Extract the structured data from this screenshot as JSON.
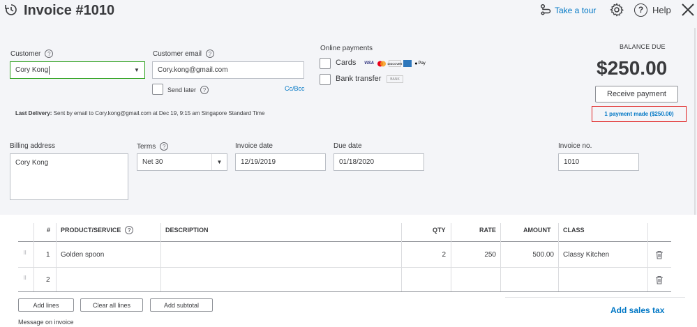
{
  "header": {
    "title": "Invoice #1010",
    "take_tour": "Take a tour",
    "help": "Help"
  },
  "customer": {
    "label": "Customer",
    "value": "Cory Kong"
  },
  "email": {
    "label": "Customer email",
    "value": "Cory.kong@gmail.com",
    "send_later": "Send later",
    "cc_bcc": "Cc/Bcc"
  },
  "online_payments": {
    "label": "Online payments",
    "cards": "Cards",
    "bank_transfer": "Bank transfer",
    "card_icons": [
      "VISA",
      "MC",
      "DISCOVER",
      "AMEX",
      "Pay"
    ],
    "bank_icon": "BANK"
  },
  "last_delivery": {
    "label": "Last Delivery:",
    "text": "Sent by email to Cory.kong@gmail.com at Dec 19, 9:15 am Singapore Standard Time"
  },
  "balance": {
    "label": "BALANCE DUE",
    "amount": "$250.00",
    "receive_payment": "Receive payment",
    "payment_made": "1 payment made ($250.00)"
  },
  "billing": {
    "label": "Billing address",
    "value": "Cory Kong"
  },
  "terms": {
    "label": "Terms",
    "value": "Net 30"
  },
  "invoice_date": {
    "label": "Invoice date",
    "value": "12/19/2019"
  },
  "due_date": {
    "label": "Due date",
    "value": "01/18/2020"
  },
  "invoice_no": {
    "label": "Invoice no.",
    "value": "1010"
  },
  "table": {
    "headers": {
      "num": "#",
      "product": "PRODUCT/SERVICE",
      "description": "DESCRIPTION",
      "qty": "QTY",
      "rate": "RATE",
      "amount": "AMOUNT",
      "class": "CLASS"
    },
    "rows": [
      {
        "num": "1",
        "product": "Golden spoon",
        "description": "",
        "qty": "2",
        "rate": "250",
        "amount": "500.00",
        "class": "Classy Kitchen"
      },
      {
        "num": "2",
        "product": "",
        "description": "",
        "qty": "",
        "rate": "",
        "amount": "",
        "class": ""
      }
    ]
  },
  "buttons": {
    "add_lines": "Add lines",
    "clear_all_lines": "Clear all lines",
    "add_subtotal": "Add subtotal"
  },
  "add_sales_tax": "Add sales tax",
  "message_label": "Message on invoice",
  "colors": {
    "link": "#0077c5",
    "green_focus": "#2ca01c",
    "highlight_box": "#e02020",
    "background": "#f4f5f8"
  }
}
